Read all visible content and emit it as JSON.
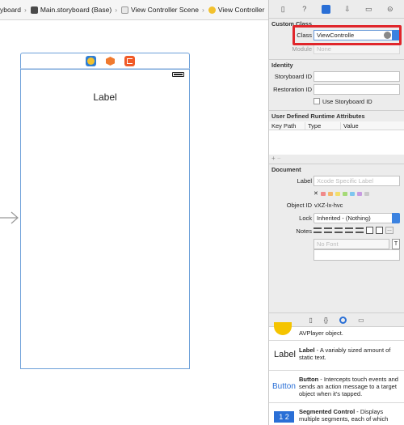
{
  "jumpbar": {
    "items": [
      "yboard",
      "Main.storyboard (Base)",
      "View Controller Scene",
      "View Controller"
    ]
  },
  "canvas": {
    "label_text": "Label"
  },
  "inspector": {
    "custom_class": {
      "title": "Custom Class",
      "class_label": "Class",
      "class_value": "ViewControlle",
      "module_label": "Module",
      "module_placeholder": "None"
    },
    "identity": {
      "title": "Identity",
      "storyboard_id_label": "Storyboard ID",
      "restoration_id_label": "Restoration ID",
      "use_storyboard_id_label": "Use Storyboard ID"
    },
    "udr": {
      "title": "User Defined Runtime Attributes",
      "columns": [
        "Key Path",
        "Type",
        "Value"
      ]
    },
    "document": {
      "title": "Document",
      "label_label": "Label",
      "label_placeholder": "Xcode Specific Label",
      "object_id_label": "Object ID",
      "object_id_value": "vXZ-lx-hvc",
      "lock_label": "Lock",
      "lock_value": "Inherited - (Nothing)",
      "notes_label": "Notes",
      "font_placeholder": "No Font",
      "swatch_colors": [
        "#f08a8a",
        "#f5b56c",
        "#f3de6a",
        "#a5da77",
        "#7ec6ef",
        "#c79be0",
        "#c9c9c9"
      ]
    },
    "library": {
      "items": [
        {
          "title": "",
          "desc": "AVPlayer object.",
          "icon": "player-icon"
        },
        {
          "title": "Label",
          "desc": " - A variably sized amount of static text.",
          "icon_text": "Label"
        },
        {
          "title": "Button",
          "desc": " - Intercepts touch events and sends an action message to a target object when it's tapped.",
          "icon_text": "Button"
        },
        {
          "title": "Segmented Control",
          "desc": " - Displays multiple segments, each of which",
          "icon_text": "1 2"
        }
      ]
    }
  }
}
